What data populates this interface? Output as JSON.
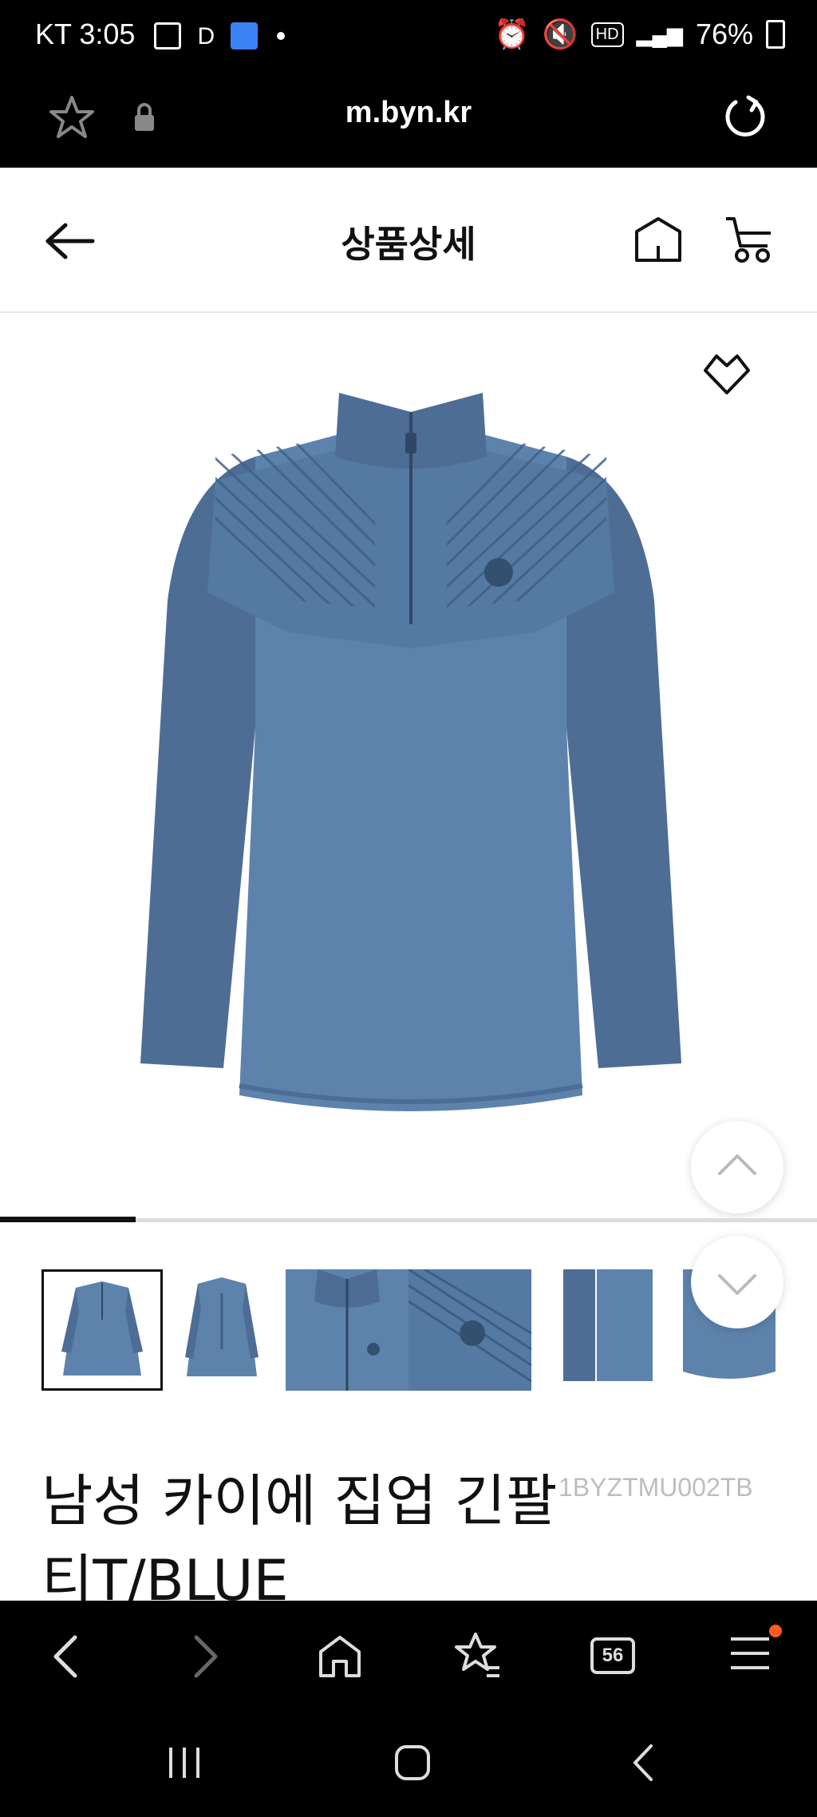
{
  "status_bar": {
    "carrier_time": "KT 3:05",
    "extra": "D",
    "battery": "76%"
  },
  "url_bar": {
    "url": "m.byn.kr"
  },
  "header": {
    "title": "상품상세"
  },
  "product": {
    "title_line1": "남성 카이에 집업 긴팔",
    "title_line2": "티T/BLUE",
    "code": "1BYZTMU002TB",
    "gallery_progress": 0.166
  },
  "browser_nav": {
    "tabs_count": "56"
  },
  "colors": {
    "jacket_sleeve": "#4d6d94",
    "jacket_body": "#5d83ad",
    "accent_dot": "#ff5a1f"
  }
}
